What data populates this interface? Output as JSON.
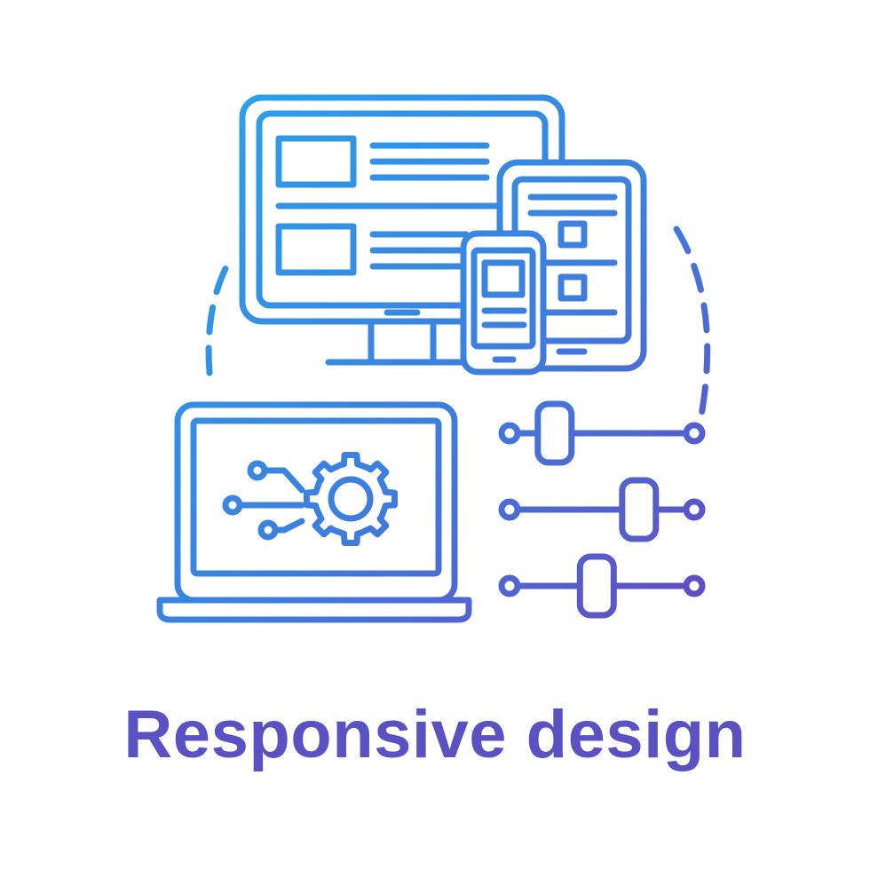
{
  "caption": {
    "text": "Responsive design"
  },
  "colors": {
    "gradient_start": "#29a4ec",
    "gradient_mid": "#3d7fde",
    "gradient_end": "#6549c0",
    "caption": "#5a52c3",
    "background": "#ffffff"
  },
  "icons": {
    "desktop": "desktop-monitor-icon",
    "tablet": "tablet-icon",
    "phone": "smartphone-icon",
    "laptop": "laptop-icon",
    "gear": "gear-icon",
    "sliders": "sliders-icon"
  },
  "sliders": {
    "knob_levels": [
      0.22,
      0.72,
      0.47
    ]
  }
}
